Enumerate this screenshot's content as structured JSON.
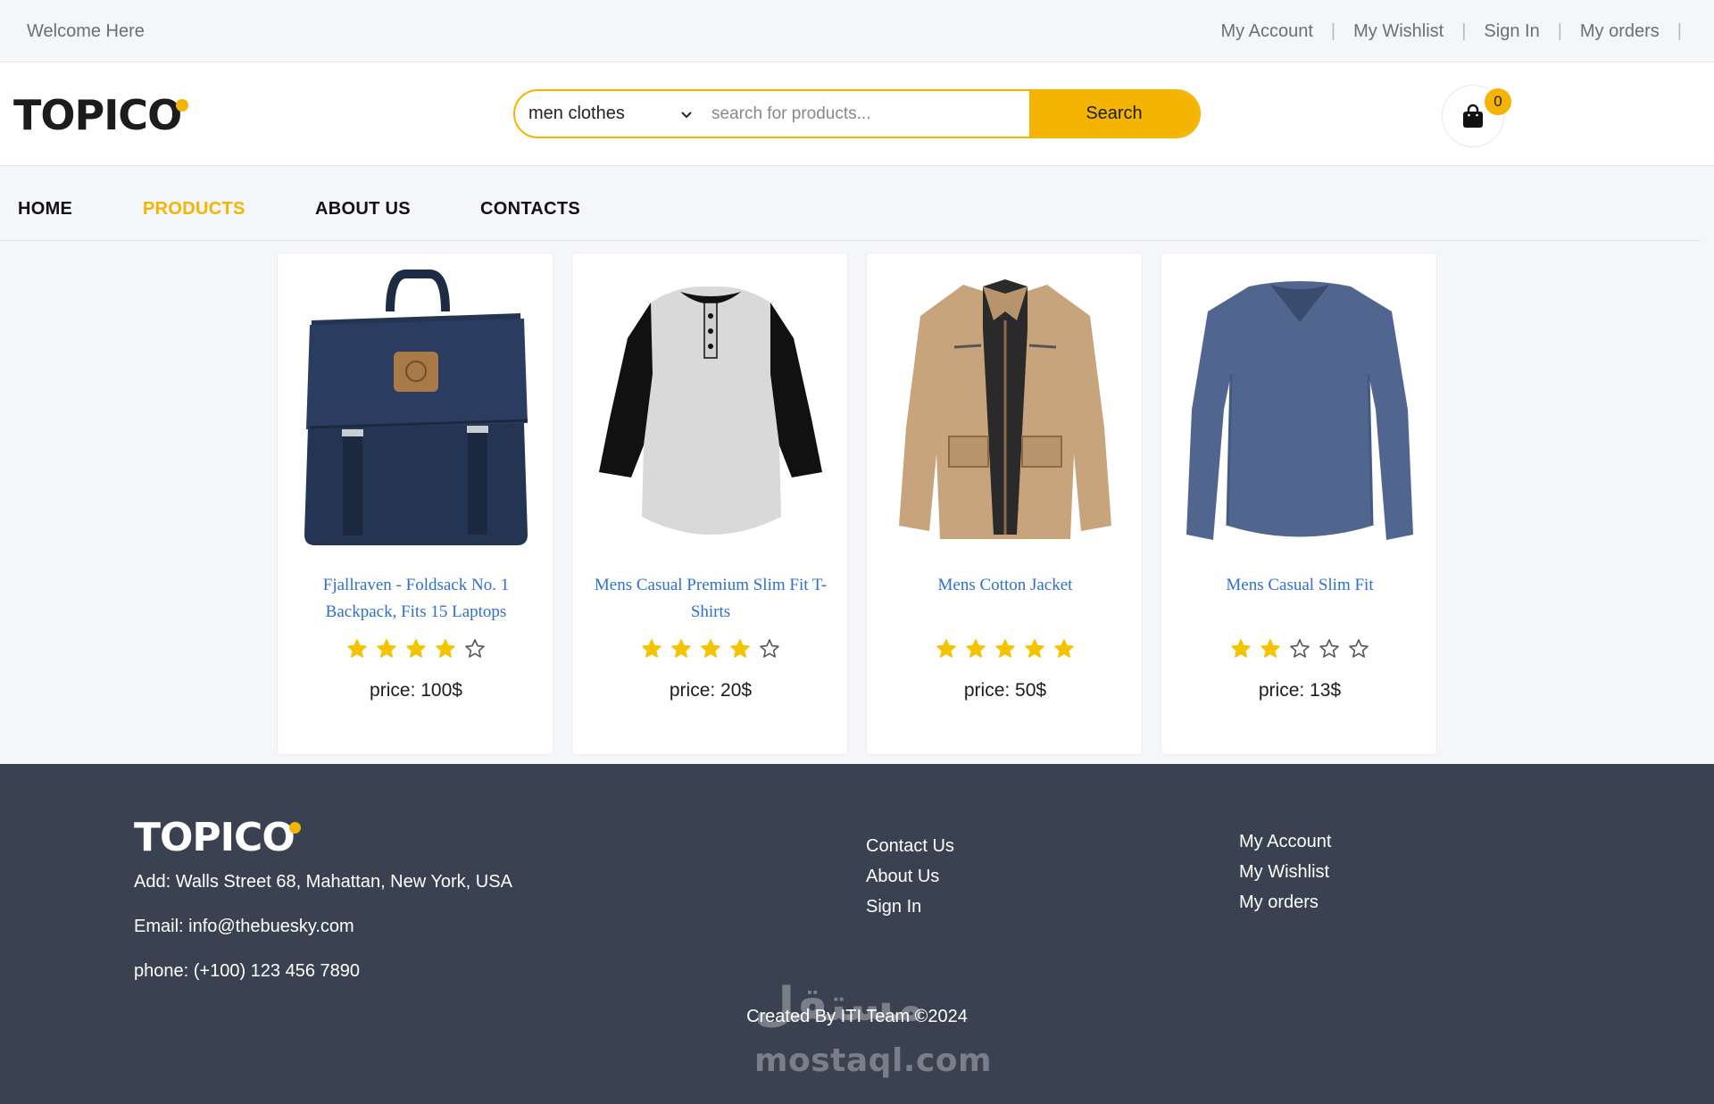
{
  "topbar": {
    "welcome": "Welcome Here",
    "links": [
      "My Account",
      "My Wishlist",
      "Sign In",
      "My orders"
    ]
  },
  "header": {
    "logo": "TOPICO",
    "category": "men clothes",
    "search_placeholder": "search for products...",
    "search_button": "Search",
    "cart_count": "0"
  },
  "nav": {
    "home": "HOME",
    "products": "PRODUCTS",
    "about": "ABOUT US",
    "contacts": "CONTACTS"
  },
  "products": [
    {
      "title": "Fjallraven - Foldsack No. 1 Backpack, Fits 15 Laptops",
      "rating": 4,
      "price": "price: 100$",
      "image": "backpack"
    },
    {
      "title": "Mens Casual Premium Slim Fit T-Shirts",
      "rating": 4,
      "price": "price: 20$",
      "image": "t-shirt"
    },
    {
      "title": "Mens Cotton Jacket",
      "rating": 5,
      "price": "price: 50$",
      "image": "jacket"
    },
    {
      "title": "Mens Casual Slim Fit",
      "rating": 2,
      "price": "price: 13$",
      "image": "long-sleeve-shirt"
    }
  ],
  "footer": {
    "logo": "TOPICO",
    "address": "Add: Walls Street 68, Mahattan, New York, USA",
    "email": "Email: info@thebuesky.com",
    "phone": "phone: (+100) 123 456 7890",
    "col1": [
      "Contact Us",
      "About Us",
      "Sign In"
    ],
    "col2": [
      "My Account",
      "My Wishlist",
      "My orders"
    ],
    "credit": "Created By ITI Team ©2024",
    "watermark_ar": "مستقل",
    "watermark_en": "mostaql.com"
  },
  "colors": {
    "accent": "#f5b400",
    "footer_bg": "#3a4150",
    "link_blue": "#2f6fd1"
  }
}
